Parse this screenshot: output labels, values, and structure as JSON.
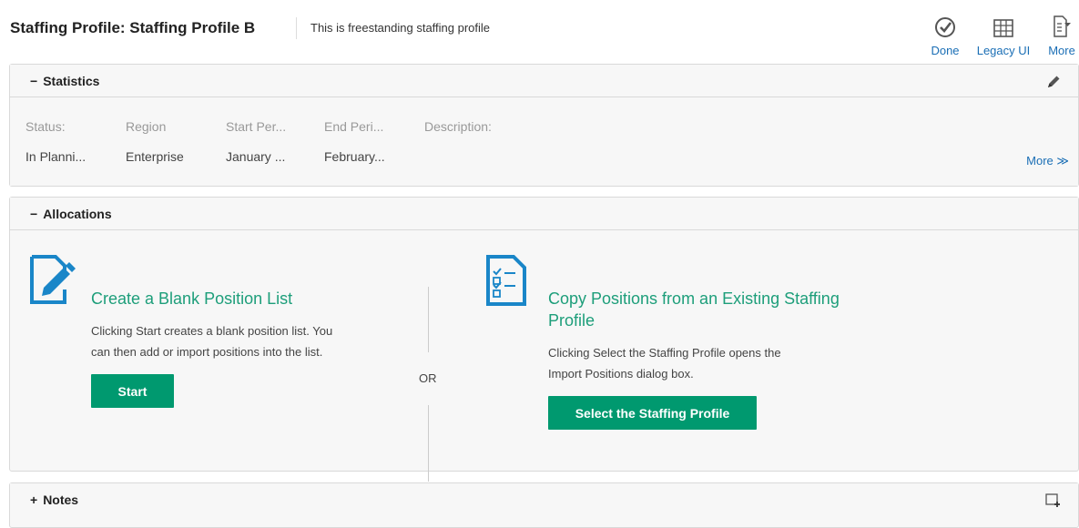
{
  "header": {
    "title": "Staffing Profile: Staffing Profile B",
    "description": "This is freestanding staffing profile",
    "actions": [
      {
        "label": "Done",
        "icon": "check-circle-icon"
      },
      {
        "label": "Legacy UI",
        "icon": "table-grid-icon"
      },
      {
        "label": "More",
        "icon": "more-menu-icon"
      }
    ]
  },
  "statistics": {
    "toggle": "−",
    "title": "Statistics",
    "fields": [
      {
        "label": "Status:",
        "value": "In Planni..."
      },
      {
        "label": "Region",
        "value": "Enterprise"
      },
      {
        "label": "Start Per...",
        "value": "January ..."
      },
      {
        "label": "End Peri...",
        "value": "February..."
      },
      {
        "label": "Description:",
        "value": ""
      }
    ],
    "more_label": "More ≫"
  },
  "allocations": {
    "toggle": "−",
    "title": "Allocations",
    "blank": {
      "title": "Create a Blank Position List",
      "text_line1": "Clicking Start creates a blank position list. You",
      "text_line2": "can then add or import positions into the list.",
      "button": "Start"
    },
    "or_label": "OR",
    "copy": {
      "title_line1": "Copy Positions from an Existing Staffing",
      "title_line2": "Profile",
      "text_line1": "Clicking Select the Staffing Profile opens the",
      "text_line2": "Import Positions dialog box.",
      "button": "Select the Staffing Profile"
    }
  },
  "notes": {
    "toggle": "+",
    "title": "Notes"
  },
  "colors": {
    "accent_green": "#00996f",
    "title_green": "#1d9e7a",
    "link_blue": "#1a6eb5",
    "icon_blue": "#1a86c8"
  }
}
